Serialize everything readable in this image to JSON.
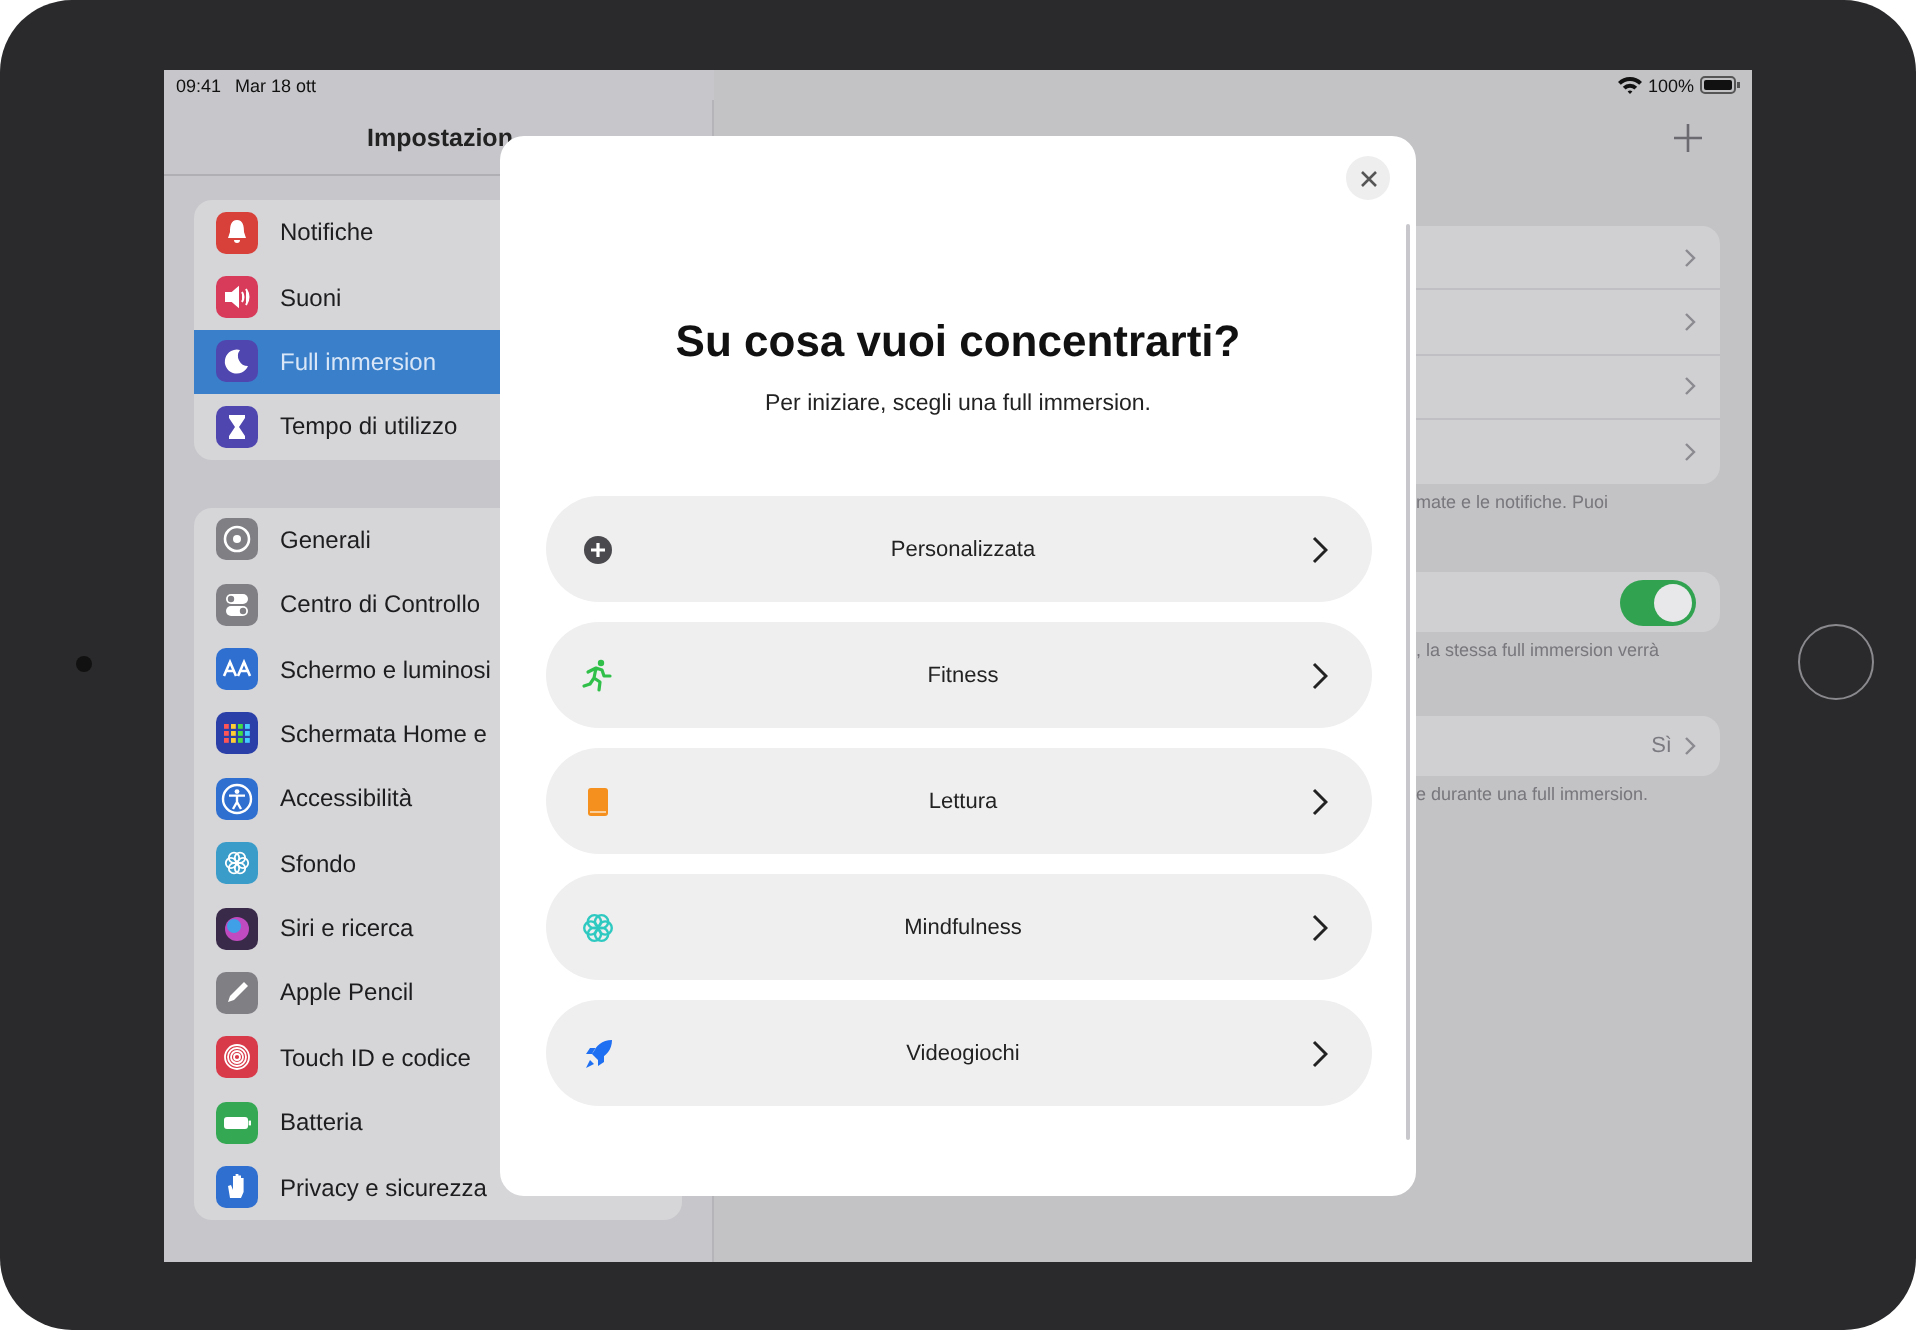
{
  "status_bar": {
    "time": "09:41",
    "date": "Mar 18 ott",
    "battery": "100%"
  },
  "sidebar": {
    "title": "Impostazion",
    "groups": [
      {
        "items": [
          {
            "label": "Notifiche",
            "color": "#d8403a",
            "selected": false
          },
          {
            "label": "Suoni",
            "color": "#d83a5a",
            "selected": false
          },
          {
            "label": "Full immersion",
            "color": "#5046b0",
            "selected": true
          },
          {
            "label": "Tempo di utilizzo",
            "color": "#5046b0",
            "selected": false
          }
        ]
      },
      {
        "items": [
          {
            "label": "Generali",
            "color": "#7f7f84",
            "selected": false
          },
          {
            "label": "Centro di Controllo",
            "color": "#7f7f84",
            "selected": false
          },
          {
            "label": "Schermo e luminosi",
            "color": "#2f6fd0",
            "selected": false
          },
          {
            "label": "Schermata Home e",
            "color": "#2a3fa8",
            "selected": false
          },
          {
            "label": "Accessibilità",
            "color": "#2f6fd0",
            "selected": false
          },
          {
            "label": "Sfondo",
            "color": "#3a9cc8",
            "selected": false
          },
          {
            "label": "Siri e ricerca",
            "color": "#3a2a4a",
            "selected": false
          },
          {
            "label": "Apple Pencil",
            "color": "#7f7f84",
            "selected": false
          },
          {
            "label": "Touch ID e codice",
            "color": "#d83a4a",
            "selected": false
          },
          {
            "label": "Batteria",
            "color": "#34a853",
            "selected": false
          },
          {
            "label": "Privacy e sicurezza",
            "color": "#2f6fd0",
            "selected": false
          }
        ]
      }
    ]
  },
  "detail": {
    "groups": [
      {
        "rows": [
          {
            "kind": "link"
          },
          {
            "kind": "link"
          },
          {
            "kind": "link"
          },
          {
            "kind": "link"
          }
        ],
        "caption": "mate e le notifiche. Puoi"
      },
      {
        "rows": [
          {
            "kind": "toggle",
            "on": true
          }
        ],
        "caption": ", la stessa full immersion verrà"
      },
      {
        "rows": [
          {
            "kind": "value",
            "value": "Sì"
          }
        ],
        "caption": "e durante una full immersion."
      }
    ]
  },
  "modal": {
    "title": "Su cosa vuoi concentrarti?",
    "subtitle": "Per iniziare, scegli una full immersion.",
    "options": [
      {
        "kind": "custom",
        "label": "Personalizzata"
      },
      {
        "kind": "fitness",
        "label": "Fitness"
      },
      {
        "kind": "reading",
        "label": "Lettura"
      },
      {
        "kind": "mindfulness",
        "label": "Mindfulness"
      },
      {
        "kind": "gaming",
        "label": "Videogiochi"
      }
    ]
  }
}
